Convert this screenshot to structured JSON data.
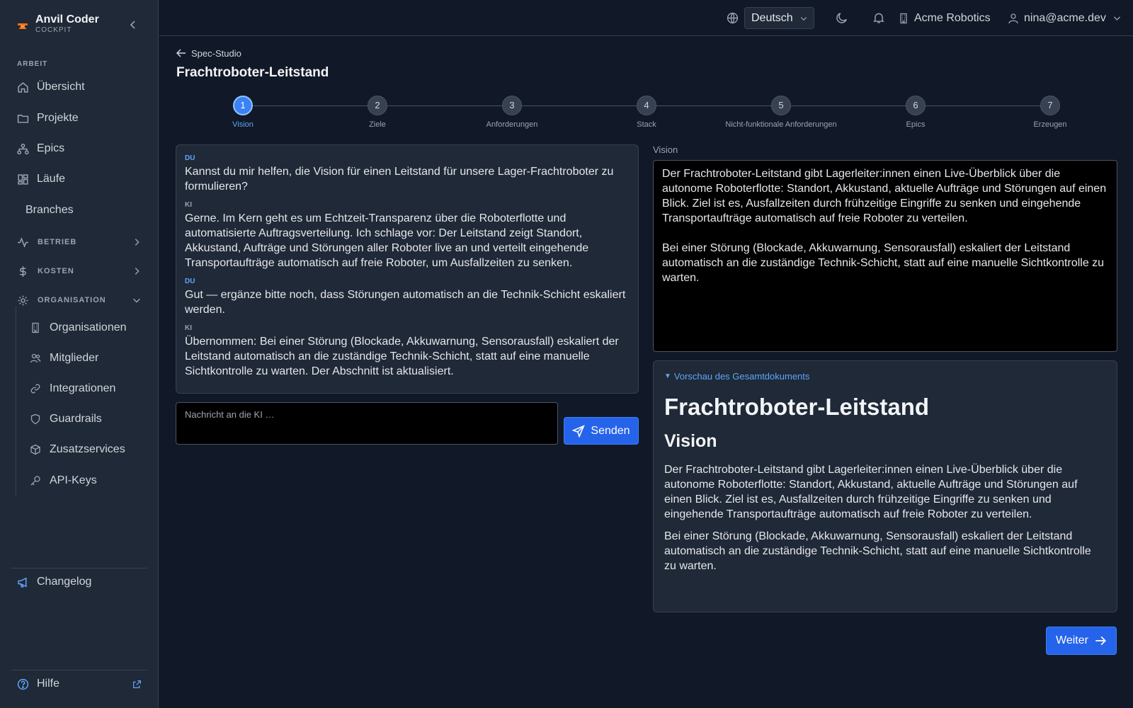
{
  "brand": {
    "name": "Anvil Coder",
    "sub": "COCKPIT"
  },
  "sidebar": {
    "section_work": "ARBEIT",
    "items": [
      {
        "label": "Übersicht",
        "icon": "home-icon"
      },
      {
        "label": "Projekte",
        "icon": "folder-icon"
      },
      {
        "label": "Epics",
        "icon": "hierarchy-icon"
      },
      {
        "label": "Läufe",
        "icon": "grid-icon"
      },
      {
        "label": "Branches"
      }
    ],
    "groups": [
      {
        "label": "BETRIEB",
        "icon": "activity-icon",
        "expanded": false
      },
      {
        "label": "KOSTEN",
        "icon": "dollar-icon",
        "expanded": false
      },
      {
        "label": "ORGANISATION",
        "icon": "gear-icon",
        "expanded": true
      }
    ],
    "org_items": [
      {
        "label": "Organisationen",
        "icon": "building-icon"
      },
      {
        "label": "Mitglieder",
        "icon": "users-icon"
      },
      {
        "label": "Integrationen",
        "icon": "link-icon"
      },
      {
        "label": "Guardrails",
        "icon": "shield-icon"
      },
      {
        "label": "Zusatzservices",
        "icon": "box-icon"
      },
      {
        "label": "API-Keys",
        "icon": "key-icon"
      }
    ],
    "changelog": "Changelog",
    "help": "Hilfe"
  },
  "topbar": {
    "language": "Deutsch",
    "org": "Acme Robotics",
    "user": "nina@acme.dev"
  },
  "page": {
    "back_label": "Spec-Studio",
    "title": "Frachtroboter-Leitstand"
  },
  "stepper": {
    "active": 1,
    "steps": [
      {
        "num": "1",
        "label": "Vision"
      },
      {
        "num": "2",
        "label": "Ziele"
      },
      {
        "num": "3",
        "label": "Anforderungen"
      },
      {
        "num": "4",
        "label": "Stack"
      },
      {
        "num": "5",
        "label": "Nicht-funktionale Anforderungen"
      },
      {
        "num": "6",
        "label": "Epics"
      },
      {
        "num": "7",
        "label": "Erzeugen"
      }
    ]
  },
  "chat": {
    "messages": [
      {
        "role": "DU",
        "text": "Kannst du mir helfen, die Vision für einen Leitstand für unsere Lager-Frachtroboter zu formulieren?"
      },
      {
        "role": "KI",
        "text": "Gerne. Im Kern geht es um Echtzeit-Transparenz über die Roboterflotte und automatisierte Auftragsverteilung. Ich schlage vor: Der Leitstand zeigt Standort, Akkustand, Aufträge und Störungen aller Roboter live an und verteilt eingehende Transportaufträge automatisch auf freie Roboter, um Ausfallzeiten zu senken."
      },
      {
        "role": "DU",
        "text": "Gut — ergänze bitte noch, dass Störungen automatisch an die Technik-Schicht eskaliert werden."
      },
      {
        "role": "KI",
        "text": "Übernommen: Bei einer Störung (Blockade, Akkuwarnung, Sensorausfall) eskaliert der Leitstand automatisch an die zuständige Technik-Schicht, statt auf eine manuelle Sichtkontrolle zu warten. Der Abschnitt ist aktualisiert."
      }
    ],
    "input_placeholder": "Nachricht an die KI …",
    "send_label": "Senden"
  },
  "vision": {
    "label": "Vision",
    "text": "Der Frachtroboter-Leitstand gibt Lagerleiter:innen einen Live-Überblick über die autonome Roboterflotte: Standort, Akkustand, aktuelle Aufträge und Störungen auf einen Blick. Ziel ist es, Ausfallzeiten durch frühzeitige Eingriffe zu senken und eingehende Transportaufträge automatisch auf freie Roboter zu verteilen.\n\nBei einer Störung (Blockade, Akkuwarnung, Sensorausfall) eskaliert der Leitstand automatisch an die zuständige Technik-Schicht, statt auf eine manuelle Sichtkontrolle zu warten."
  },
  "preview": {
    "toggle": "Vorschau des Gesamtdokuments",
    "h1": "Frachtroboter-Leitstand",
    "h2": "Vision",
    "p1": "Der Frachtroboter-Leitstand gibt Lagerleiter:innen einen Live-Überblick über die autonome Roboterflotte: Standort, Akkustand, aktuelle Aufträge und Störungen auf einen Blick. Ziel ist es, Ausfallzeiten durch frühzeitige Eingriffe zu senken und eingehende Transportaufträge automatisch auf freie Roboter zu verteilen.",
    "p2": "Bei einer Störung (Blockade, Akkuwarnung, Sensorausfall) eskaliert der Leitstand automatisch an die zuständige Technik-Schicht, statt auf eine manuelle Sichtkontrolle zu warten."
  },
  "next_label": "Weiter",
  "colors": {
    "accent": "#3b82f6",
    "bg": "#111827",
    "panel": "#1f2937",
    "brand_orange": "#f97316"
  }
}
